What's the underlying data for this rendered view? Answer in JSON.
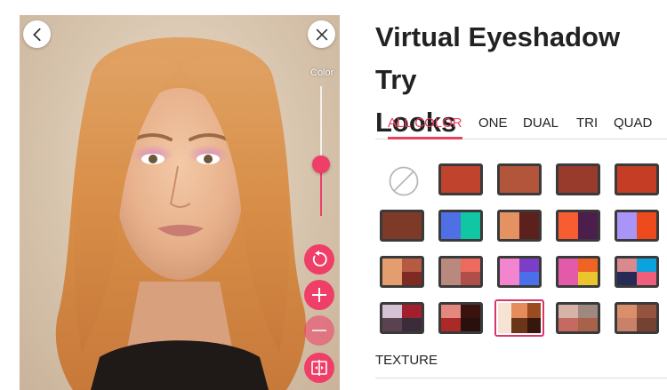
{
  "header": {
    "title_line1": "Virtual Eyeshadow Try",
    "title_line2": "Looks"
  },
  "photo_panel": {
    "back_icon": "chevron-left-icon",
    "close_icon": "close-icon",
    "slider_label": "Color",
    "slider_value": 0.4,
    "action_icons": [
      "reset-icon",
      "plus-icon",
      "minus-icon",
      "compare-icon"
    ]
  },
  "tabs": [
    {
      "label": "ALL COLOR",
      "active": true
    },
    {
      "label": "ONE",
      "active": false
    },
    {
      "label": "DUAL",
      "active": false
    },
    {
      "label": "TRI",
      "active": false
    },
    {
      "label": "QUAD",
      "active": false
    }
  ],
  "palettes": {
    "none_icon": "no-color-icon",
    "rows": [
      [
        {
          "layout": "one",
          "colors": [
            "#c0432d"
          ]
        },
        {
          "layout": "one",
          "colors": [
            "#b2553a"
          ]
        },
        {
          "layout": "one",
          "colors": [
            "#983a2c"
          ]
        },
        {
          "layout": "one",
          "colors": [
            "#c43d24"
          ]
        }
      ],
      [
        {
          "layout": "one",
          "colors": [
            "#7e3a28"
          ]
        },
        {
          "layout": "dual",
          "colors": [
            "#4f6fe4",
            "#11c6a3"
          ]
        },
        {
          "layout": "dual",
          "colors": [
            "#e59262",
            "#5c201d"
          ]
        },
        {
          "layout": "dual",
          "colors": [
            "#f75d31",
            "#4c1e4c"
          ]
        },
        {
          "layout": "dual",
          "colors": [
            "#a895f7",
            "#ed4a1d"
          ]
        }
      ],
      [
        {
          "layout": "tri",
          "colors": [
            "#e49d6e",
            "#b65a42",
            "#7f2b24"
          ]
        },
        {
          "layout": "tri",
          "colors": [
            "#b8897c",
            "#ef6a5e",
            "#b04f4a"
          ]
        },
        {
          "layout": "tri",
          "colors": [
            "#f384ce",
            "#7c3ec7",
            "#4a6fe8"
          ]
        },
        {
          "layout": "tri",
          "colors": [
            "#e35ba8",
            "#ef6324",
            "#ecc42e"
          ]
        },
        {
          "layout": "quad",
          "colors": [
            "#d88a8f",
            "#0aa3de",
            "#262a55",
            "#ef5e7b"
          ]
        }
      ],
      [
        {
          "layout": "quad",
          "colors": [
            "#d4c2d4",
            "#a21f2d",
            "#5a4250",
            "#3b2c3b"
          ]
        },
        {
          "layout": "quad",
          "colors": [
            "#e3877f",
            "#3a130e",
            "#a92a26",
            "#2a100c"
          ]
        },
        {
          "layout": "quad-selected",
          "colors": [
            "#f6e3d4",
            "#e58b5c",
            "#9c4a1f",
            "#6b3519",
            "#36170e"
          ]
        },
        {
          "layout": "quad",
          "colors": [
            "#d6b3a7",
            "#9e8980",
            "#c66961",
            "#a8624a"
          ]
        },
        {
          "layout": "quad",
          "colors": [
            "#d98f69",
            "#95543d",
            "#c98269",
            "#754232"
          ]
        }
      ]
    ]
  },
  "texture": {
    "label": "TEXTURE"
  },
  "colors": {
    "accent": "#ef3e68",
    "tab_active": "#e8405e"
  }
}
